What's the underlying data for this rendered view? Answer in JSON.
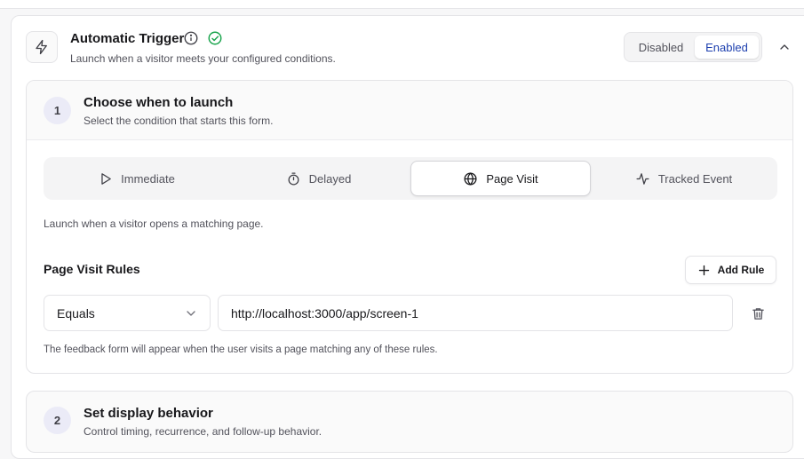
{
  "trigger": {
    "title": "Automatic Trigger",
    "description": "Launch when a visitor meets your configured conditions.",
    "toggle": {
      "disabled_label": "Disabled",
      "enabled_label": "Enabled",
      "selected": "Enabled"
    }
  },
  "step1": {
    "number": "1",
    "title": "Choose when to launch",
    "subtitle": "Select the condition that starts this form.",
    "tabs": [
      {
        "label": "Immediate",
        "icon": "play-icon"
      },
      {
        "label": "Delayed",
        "icon": "stopwatch-icon"
      },
      {
        "label": "Page Visit",
        "icon": "globe-icon",
        "active": true
      },
      {
        "label": "Tracked Event",
        "icon": "activity-icon"
      }
    ],
    "note": "Launch when a visitor opens a matching page.",
    "rules": {
      "title": "Page Visit Rules",
      "add_label": "Add Rule",
      "match_type": "Equals",
      "url_value": "http://localhost:3000/app/screen-1",
      "note": "The feedback form will appear when the user visits a page matching any of these rules."
    }
  },
  "step2": {
    "number": "2",
    "title": "Set display behavior",
    "subtitle": "Control timing, recurrence, and follow-up behavior."
  },
  "colors": {
    "accent": "#1e40af",
    "success": "#16a34a",
    "border": "#e4e4e7"
  }
}
